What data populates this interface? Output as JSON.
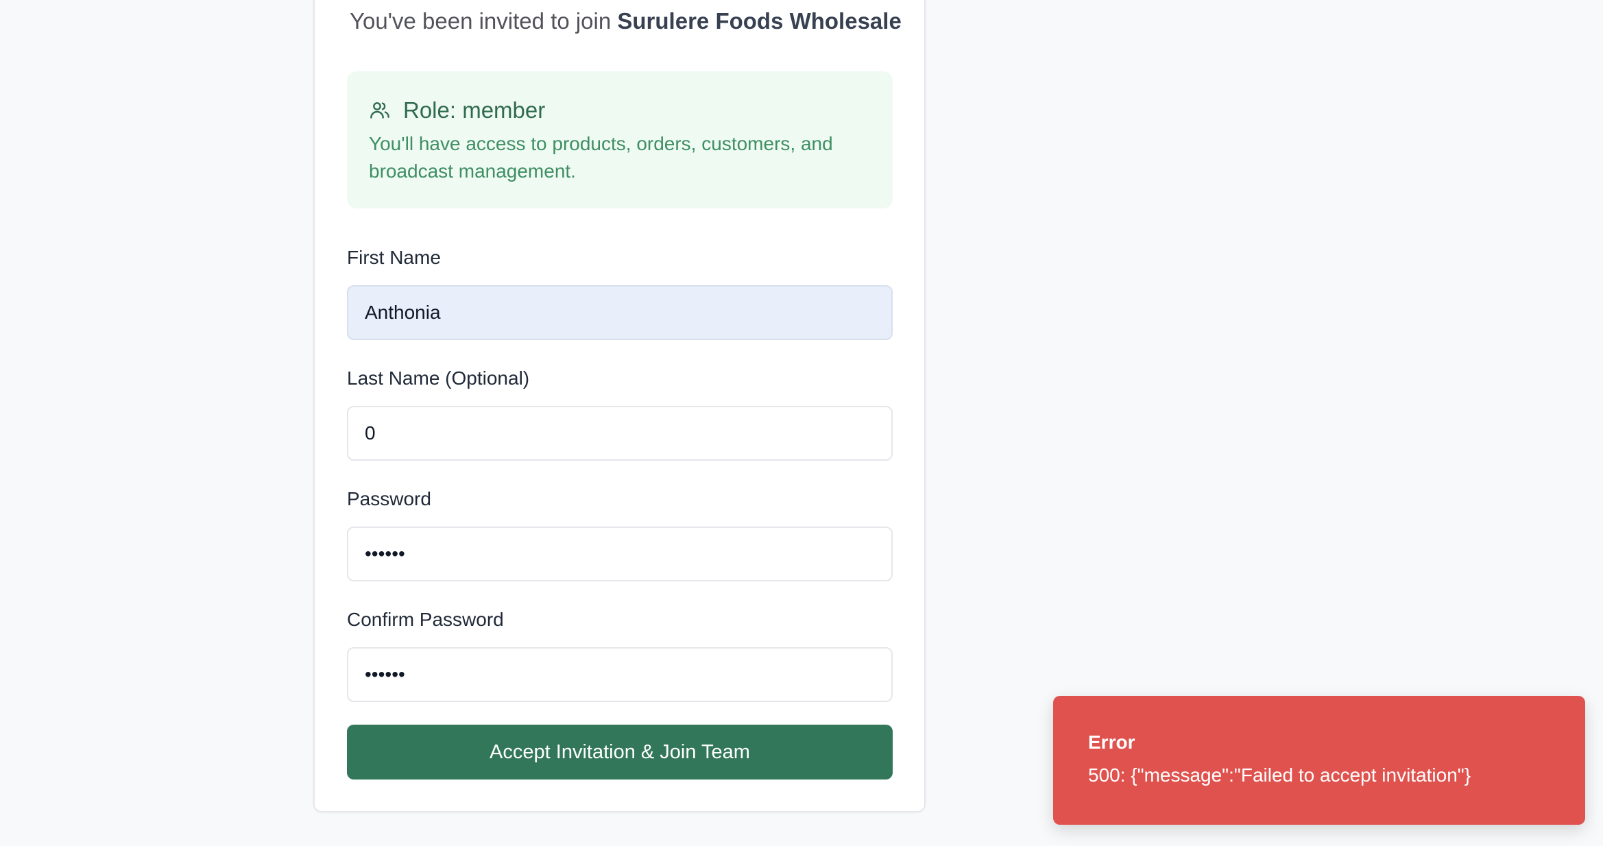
{
  "header": {
    "invite_prefix": "You've been invited to join ",
    "organization_name": "Surulere Foods Wholesale"
  },
  "role": {
    "icon": "users-icon",
    "title": "Role: member",
    "description": "You'll have access to products, orders, customers, and broadcast management."
  },
  "form": {
    "first_name": {
      "label": "First Name",
      "value": "Anthonia"
    },
    "last_name": {
      "label": "Last Name (Optional)",
      "value": "0"
    },
    "password": {
      "label": "Password",
      "value": "••••••"
    },
    "confirm_password": {
      "label": "Confirm Password",
      "value": "••••••"
    },
    "submit_label": "Accept Invitation & Join Team"
  },
  "toast": {
    "title": "Error",
    "message": "500: {\"message\":\"Failed to accept invitation\"}"
  },
  "colors": {
    "page_background": "#f8f9fa",
    "role_box_background": "#effaf3",
    "role_text": "#2f6b4d",
    "primary_button": "#33775a",
    "error_toast": "#df524e",
    "autofill_background": "#e8effb"
  }
}
